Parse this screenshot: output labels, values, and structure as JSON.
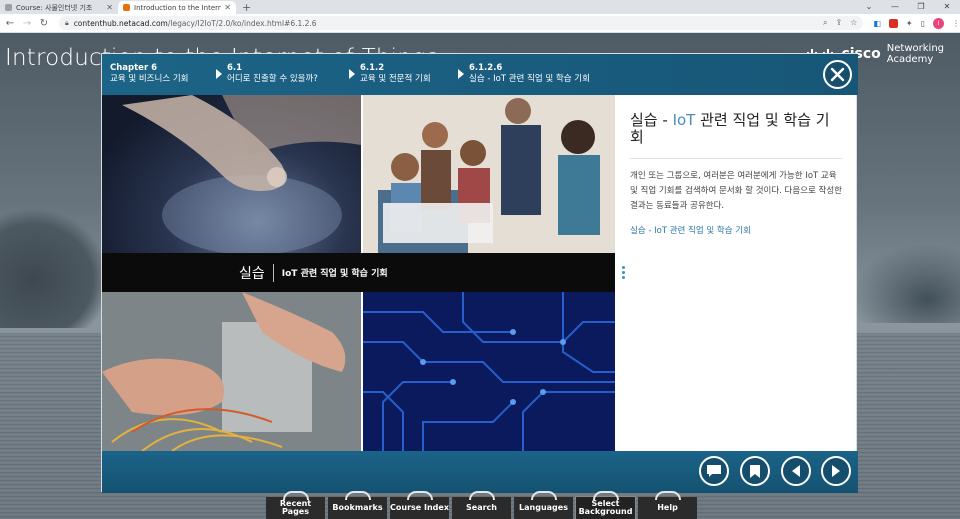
{
  "browser": {
    "tabs": [
      {
        "title": "Course: 사물인터넷 기초",
        "active": false,
        "favicon_color": "#9aa0a6"
      },
      {
        "title": "Introduction to the Internet of",
        "active": true,
        "favicon_color": "#e8710a"
      }
    ],
    "new_tab_symbol": "+",
    "url_host": "contenthub.netacad.com",
    "url_path": "/legacy/I2IoT/2.0/ko/index.html#6.1.2.6",
    "avatar_letter": "I"
  },
  "page": {
    "course_title": "Introduction to the Internet of Things",
    "logo_brand": "cisco",
    "logo_line1": "Networking",
    "logo_line2": "Academy"
  },
  "breadcrumb": [
    {
      "num": "Chapter 6",
      "label": "교육 및 비즈니스 기회"
    },
    {
      "num": "6.1",
      "label": "어디로 진출할 수 있을까?"
    },
    {
      "num": "6.1.2",
      "label": "교육 및 전문적 기회"
    },
    {
      "num": "6.1.2.6",
      "label": "실습 - IoT 관련 직업 및 학습 기회"
    }
  ],
  "banner": {
    "big": "실습",
    "small": "IoT 관련 직업 및 학습 기회"
  },
  "side": {
    "title_prefix": "실습 - ",
    "title_iot": "IoT",
    "title_rest": " 관련 직업 및 학습 기회",
    "description": "개인 또는 그룹으로, 여러분은 여러분에게 가능한 IoT 교육 및 직업 기회를 검색하여 문서화 할 것이다. 다음으로 작성한 결과는 동료들과 공유한다.",
    "link": "실습 - IoT 관련 직업 및 학습 기회"
  },
  "bottom_menu": [
    {
      "label": "Recent Pages"
    },
    {
      "label": "Bookmarks"
    },
    {
      "label": "Course Index"
    },
    {
      "label": "Search"
    },
    {
      "label": "Languages"
    },
    {
      "label": "Select Background"
    },
    {
      "label": "Help"
    }
  ],
  "colors": {
    "header_blue": "#1a5e80",
    "link_blue": "#2d78a8",
    "accent_blue": "#4a8cbc"
  }
}
